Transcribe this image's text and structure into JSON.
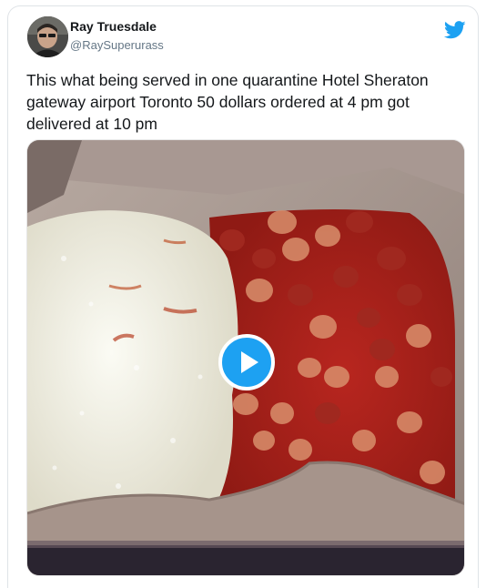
{
  "tweet": {
    "author_name": "Ray Truesdale",
    "author_handle": "@RaySuperurass",
    "text": "This what being served in one quarantine Hotel Sheraton gateway airport Toronto 50 dollars ordered at 4 pm got delivered at 10 pm"
  },
  "icons": {
    "brand": "twitter-bird-icon",
    "media_control": "play-icon"
  },
  "colors": {
    "brand_blue": "#1da1f2",
    "name_text": "#14171a",
    "handle_text": "#657786"
  }
}
